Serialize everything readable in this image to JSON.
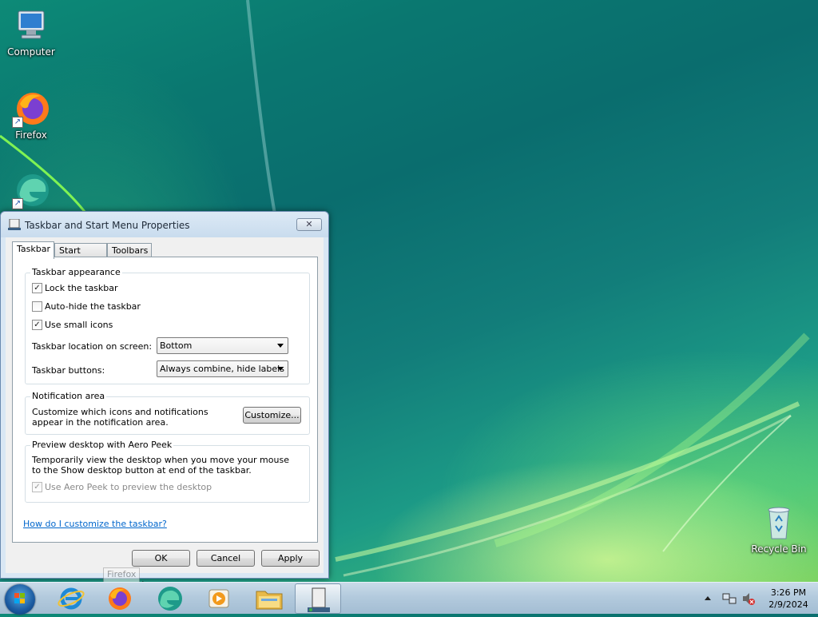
{
  "desktop": {
    "icons": [
      {
        "label": "Computer",
        "icon": "computer-icon"
      },
      {
        "label": "Firefox",
        "icon": "firefox-icon"
      },
      {
        "label": "",
        "icon": "edge-icon"
      },
      {
        "label": "Recycle Bin",
        "icon": "recycle-bin-icon"
      }
    ]
  },
  "dialog": {
    "title": "Taskbar and Start Menu Properties",
    "close_glyph": "✕",
    "tabs": [
      "Taskbar",
      "Start Menu",
      "Toolbars"
    ],
    "active_tab": "Taskbar",
    "appearance": {
      "label": "Taskbar appearance",
      "lock": {
        "label": "Lock the taskbar",
        "checked": true
      },
      "autohide": {
        "label": "Auto-hide the taskbar",
        "checked": false
      },
      "small_icons": {
        "label": "Use small icons",
        "checked": true
      },
      "location_label": "Taskbar location on screen:",
      "location_value": "Bottom",
      "buttons_label": "Taskbar buttons:",
      "buttons_value": "Always combine, hide labels"
    },
    "notification": {
      "label": "Notification area",
      "text": "Customize which icons and notifications appear in the notification area.",
      "customize_button": "Customize..."
    },
    "aero_peek": {
      "label": "Preview desktop with Aero Peek",
      "text": "Temporarily view the desktop when you move your mouse to the Show desktop button at end of the taskbar.",
      "checkbox": {
        "label": "Use Aero Peek to preview the desktop",
        "checked": true,
        "disabled": true
      }
    },
    "help_link": "How do I customize the taskbar?",
    "ok_button": "OK",
    "cancel_button": "Cancel",
    "apply_button": "Apply"
  },
  "tooltip": "Firefox",
  "taskbar": {
    "items": [
      "internet-explorer-icon",
      "firefox-icon",
      "edge-icon",
      "media-player-icon",
      "file-explorer-icon",
      "taskbar-properties-icon"
    ],
    "clock": {
      "time": "3:26 PM",
      "date": "2/9/2024"
    }
  }
}
